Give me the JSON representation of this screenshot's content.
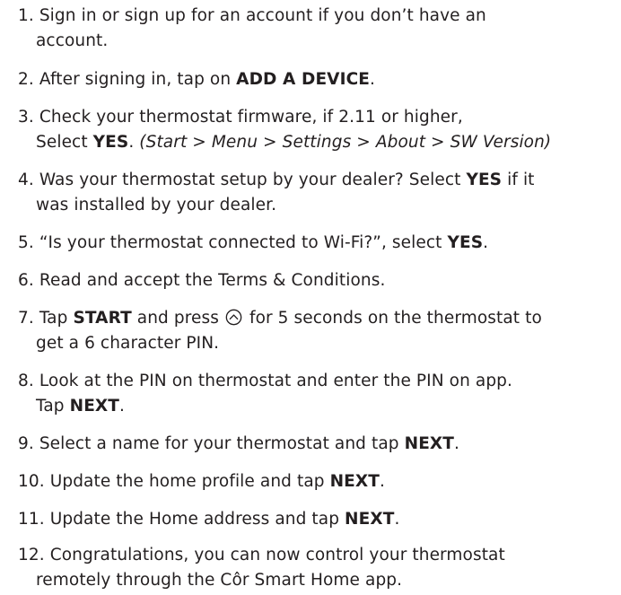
{
  "steps": [
    {
      "number": "1.",
      "line1": "Sign in or sign up for an account if you don’t have an",
      "line2": "account."
    },
    {
      "number": "2.",
      "text": "After signing in, tap on",
      "bold": "ADD A DEVICE",
      "end": "."
    },
    {
      "number": "3.",
      "line1": "Check your thermostat firmware, if 2.11 or higher,",
      "line2_prefix": "Select",
      "line2_bold": "YES",
      "line2_mid": ".",
      "line2_path": "(Start > Menu > Settings > About > SW Version)"
    },
    {
      "number": "4.",
      "line1_prefix": "Was your thermostat setup by your dealer? Select",
      "line1_bold": "YES",
      "line1_suffix": "if it",
      "line2": "was installed by your dealer."
    },
    {
      "number": "5.",
      "text": "“Is your thermostat connected to Wi-Fi?”, select",
      "bold": "YES",
      "end": "."
    },
    {
      "number": "6.",
      "text": "Read and accept the Terms & Conditions."
    },
    {
      "number": "7.",
      "line1_prefix": "Tap",
      "line1_bold": "START",
      "line1_mid": "and press",
      "icon": "up-chevron-circle-icon",
      "line1_suffix": "for 5 seconds on the thermostat to",
      "line2": "get a 6 character PIN."
    },
    {
      "number": "8.",
      "line1": "Look at the PIN on thermostat and enter the PIN on app.",
      "line2_prefix": "Tap",
      "line2_bold": "NEXT",
      "line2_end": "."
    },
    {
      "number": "9.",
      "text": "Select a name for your thermostat and tap",
      "bold": "NEXT",
      "end": "."
    },
    {
      "number": "10.",
      "text": "Update the home profile and tap",
      "bold": "NEXT",
      "end": "."
    },
    {
      "number": "11.",
      "text": "Update the Home address and tap",
      "bold": "NEXT",
      "end": "."
    },
    {
      "number": "12.",
      "line1": "Congratulations, you can now control your thermostat",
      "line2": "remotely through the Côr Smart Home app."
    }
  ]
}
